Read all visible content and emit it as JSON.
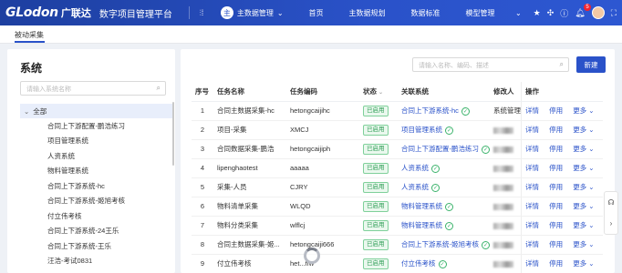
{
  "header": {
    "logo": "GLodon",
    "logo_cn": "广联达",
    "platform": "数字项目管理平台",
    "app_select": "主数据管理",
    "app_avatar": "主",
    "nav": [
      "首页",
      "主数据规划",
      "数据标准",
      "模型管理"
    ],
    "notification_count": "5"
  },
  "tabs": {
    "active": "被动采集"
  },
  "left": {
    "title": "系统",
    "search_placeholder": "请输入系统名称",
    "root": "全部",
    "items": [
      "合同上下游配置-鹏浩练习",
      "项目管理系统",
      "人资系统",
      "物料管理系统",
      "合同上下游系统-hc",
      "合同上下游系统-姬旭考核",
      "付立伟考核",
      "合同上下游系统-24王乐",
      "合同上下游系统-王乐",
      "汪浩-考试0831"
    ]
  },
  "right": {
    "search_placeholder": "请输入名称、编码、描述",
    "new_button": "新建",
    "columns": [
      "序号",
      "任务名称",
      "任务编码",
      "状态",
      "关联系统",
      "修改人",
      "操作"
    ],
    "rows": [
      {
        "seq": "1",
        "name": "合同主数据采集-hc",
        "code": "hetongcaijihc",
        "status": "已启用",
        "rel": "合同上下游系统-hc",
        "mod": "系统管理"
      },
      {
        "seq": "2",
        "name": "项目-采集",
        "code": "XMCJ",
        "status": "已启用",
        "rel": "项目管理系统",
        "mod": ""
      },
      {
        "seq": "3",
        "name": "合同数据采集-鹏浩",
        "code": "hetongcaijiph",
        "status": "已启用",
        "rel": "合同上下游配置-鹏浩练习",
        "mod": ""
      },
      {
        "seq": "4",
        "name": "lipenghaotest",
        "code": "aaaaa",
        "status": "已启用",
        "rel": "人资系统",
        "mod": ""
      },
      {
        "seq": "5",
        "name": "采集-人员",
        "code": "CJRY",
        "status": "已启用",
        "rel": "人资系统",
        "mod": ""
      },
      {
        "seq": "6",
        "name": "物料清单采集",
        "code": "WLQD",
        "status": "已启用",
        "rel": "物料管理系统",
        "mod": ""
      },
      {
        "seq": "7",
        "name": "物料分类采集",
        "code": "wlflcj",
        "status": "已启用",
        "rel": "物料管理系统",
        "mod": ""
      },
      {
        "seq": "8",
        "name": "合同主数据采集-姬...",
        "code": "hetongcaiji666",
        "status": "已启用",
        "rel": "合同上下游系统-姬旭考核",
        "mod": ""
      },
      {
        "seq": "9",
        "name": "付立伟考核",
        "code": "het...ffw",
        "status": "已启用",
        "rel": "付立伟考核",
        "mod": ""
      }
    ],
    "ops": {
      "detail": "详情",
      "disable": "停用",
      "more": "更多"
    }
  }
}
